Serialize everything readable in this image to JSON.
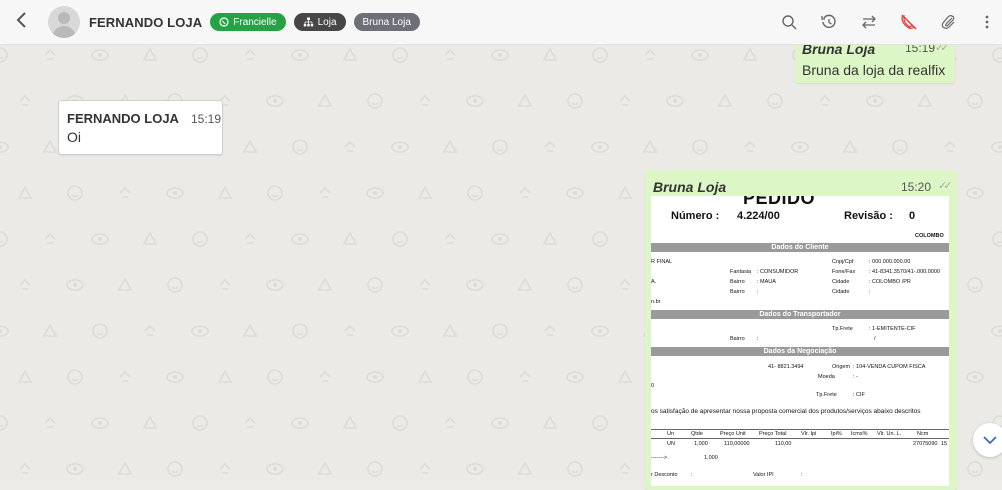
{
  "header": {
    "back_icon": "chevron-left-icon",
    "contact_name": "FERNANDO LOJA",
    "tags": [
      {
        "label": "Francielle",
        "icon": "whatsapp-icon",
        "color": "#25a244"
      },
      {
        "label": "Loja",
        "icon": "sitemap-icon",
        "color": "#474747"
      },
      {
        "label": "Bruna Loja",
        "color": "#6e7077"
      }
    ],
    "actions": [
      "search-icon",
      "history-icon",
      "transfer-icon",
      "end-call-icon",
      "paperclip-icon",
      "more-vertical-icon"
    ]
  },
  "colors": {
    "outgoing_bubble": "#dcf7c5",
    "incoming_bubble": "#ffffff",
    "accent_red": "#e53935"
  },
  "messages": [
    {
      "sender": "Bruna Loja",
      "time": "15:19",
      "text": "Bruna da loja da realfix",
      "direction": "out",
      "status": "read"
    },
    {
      "sender": "FERNANDO LOJA",
      "time": "15:19",
      "text": "Oi",
      "direction": "in"
    },
    {
      "sender": "Bruna Loja",
      "time": "15:20",
      "direction": "out",
      "status": "read",
      "type": "image"
    }
  ],
  "document": {
    "title": "PEDIDO",
    "numero_label": "Número :",
    "numero_value": "4.224/00",
    "revisao_label": "Revisão :",
    "revisao_value": "0",
    "city": "COLOMBO",
    "section_cliente": "Dados do Cliente",
    "section_transportador": "Dados do Transportador",
    "section_negociacao": "Dados da Negociação",
    "cliente_lines": {
      "rfinal": "R FINAL",
      "cnpj_label": "Cnpj/Cpf",
      "cnpj_value": ":   000.000.000.00",
      "fantasia_label": "Fantasia",
      "fantasia_value": ":  CONSUMIDOR",
      "fone_label": "Fone/Fax",
      "fone_value": ":  41-8341.3570/41-.000.0000",
      "a": "A.",
      "bairro_label": "Bairro",
      "bairro_value": ":  MAUA",
      "cidade_label": "Cidade",
      "cidade_value": ":  COLOMBO          /PR",
      "bairro2_label": "Bairro",
      "bairro2_value": ":",
      "cidade2_label": "Cidade",
      "cidade2_value": ":",
      "email_frag": "n.br"
    },
    "transp_lines": {
      "tpfrete_label": "Tp.Frete",
      "tpfrete_value": ":   1-EMITENTE-CIF",
      "bairro_label": "Bairro",
      "bairro_value": ":",
      "slash": "/"
    },
    "neg_lines": {
      "phone": "41- 8821.3494",
      "origem_label": "Origem",
      "origem_value": ":   104-VENDA CUPOM FISCA",
      "moeda_label": "Moeda",
      "moeda_value": ":   -",
      "zero": "0",
      "tpfrete_label": "Tp.Frete",
      "tpfrete_value": ":   CIF"
    },
    "intro": "os satisfação de apresentar nossa proposta comercial dos produtos/serviços abaixo descritos",
    "table_headers": [
      "Un",
      "Qtde",
      "Preço Unit",
      "Preço Total",
      "Vlr. Ipi",
      "Ipi%",
      "Icms%",
      "Vlr. Un. L.",
      "Ncm"
    ],
    "table_row": [
      "UN",
      "1,000",
      "110,00000",
      "110,00",
      "27075090",
      "15"
    ],
    "total_arrow": "------->",
    "total_qty": "1,000",
    "desconto_label": "r Desconto",
    "desconto_value": ":",
    "valor_ipi_label": "Valor IPI",
    "valor_ipi_value": ":"
  },
  "scroll_down_icon": "chevron-down-icon"
}
